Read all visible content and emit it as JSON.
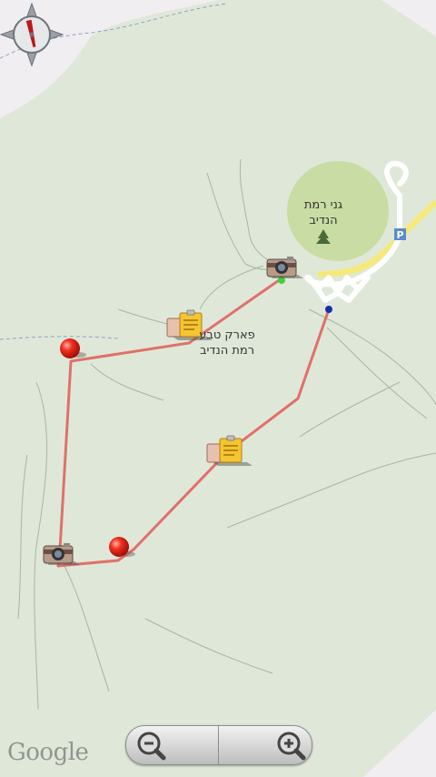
{
  "map": {
    "labels": {
      "park_line1": "פארק טבע",
      "park_line2": "רמת הנדיב",
      "gardens_line1": "גני רמת",
      "gardens_line2": "הנדיב",
      "parking": "P"
    },
    "attribution": "Google",
    "colors": {
      "land": "#dfe8d8",
      "gardens": "#c8dca4",
      "route": "#e0706b",
      "road": "#ffffff",
      "highway": "#f6e97c"
    },
    "markers": [
      {
        "type": "camera",
        "name": "camera-marker-north"
      },
      {
        "type": "note",
        "name": "note-marker-center"
      },
      {
        "type": "pin",
        "name": "red-pin-west"
      },
      {
        "type": "note",
        "name": "note-marker-south"
      },
      {
        "type": "camera",
        "name": "camera-marker-southwest"
      },
      {
        "type": "pin",
        "name": "red-pin-south"
      }
    ]
  },
  "controls": {
    "compass": "compass-icon",
    "zoom_out": "zoom-out-icon",
    "zoom_in": "zoom-in-icon"
  }
}
